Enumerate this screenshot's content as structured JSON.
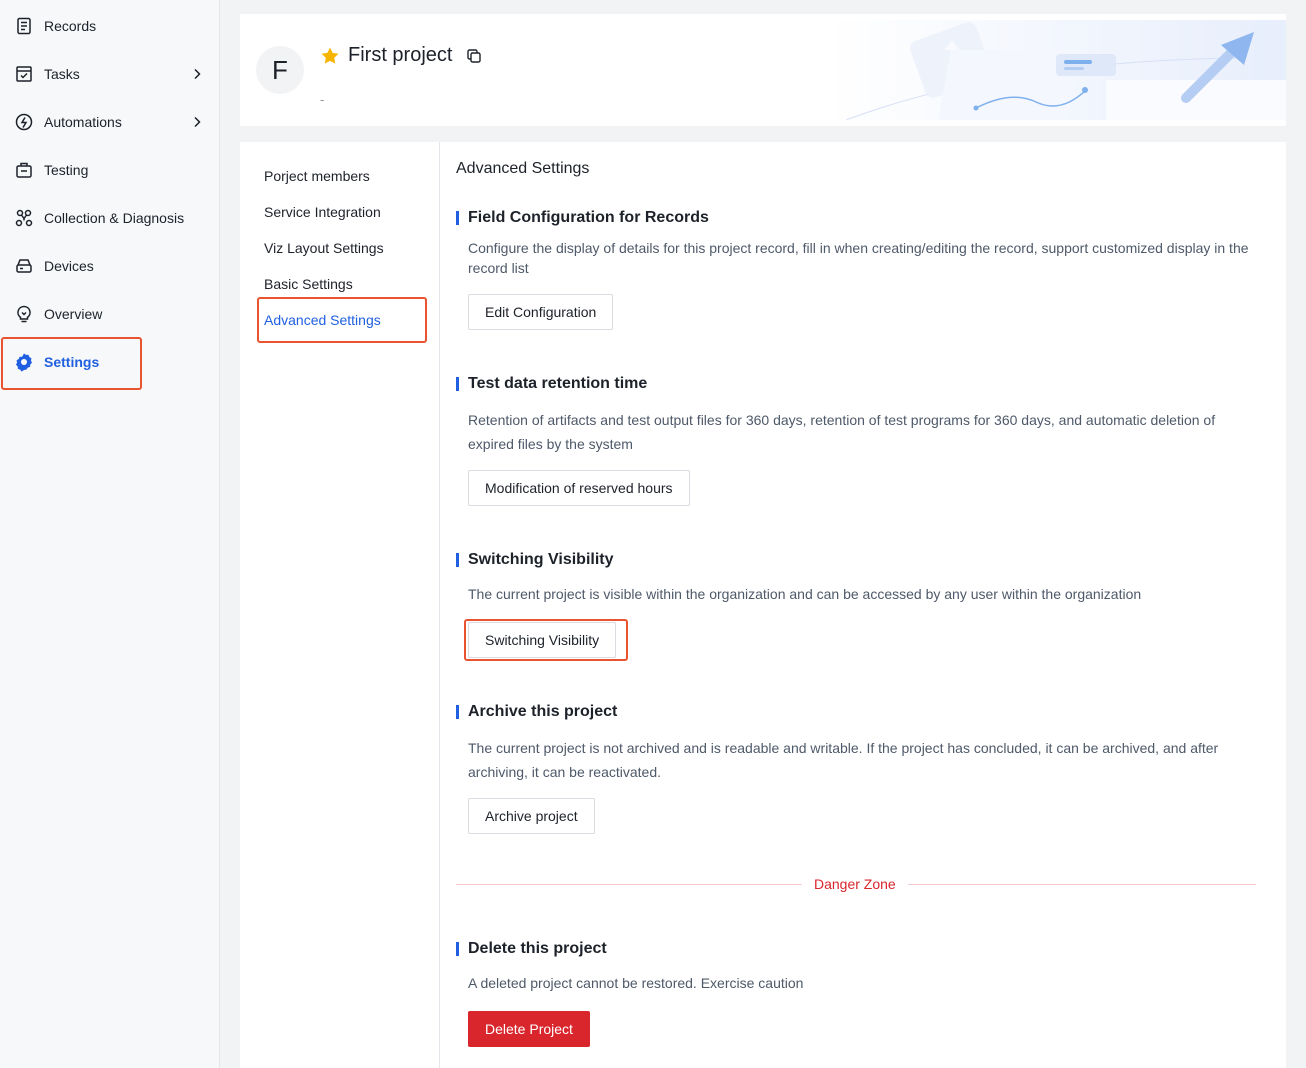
{
  "sidebar": {
    "items": [
      {
        "label": "Records",
        "icon": "records-icon"
      },
      {
        "label": "Tasks",
        "icon": "tasks-icon"
      },
      {
        "label": "Automations",
        "icon": "automations-icon"
      },
      {
        "label": "Testing",
        "icon": "testing-icon"
      },
      {
        "label": "Collection & Diagnosis",
        "icon": "collection-diagnosis-icon"
      },
      {
        "label": "Devices",
        "icon": "devices-icon"
      },
      {
        "label": "Overview",
        "icon": "overview-icon"
      },
      {
        "label": "Settings",
        "icon": "settings-icon"
      }
    ],
    "active": "Settings",
    "accent_color": "#1f5fe0"
  },
  "project": {
    "avatar_letter": "F",
    "title": "First project",
    "subtitle": "-",
    "favorite": true
  },
  "settings_nav": {
    "items": [
      {
        "label": "Porject members"
      },
      {
        "label": "Service Integration"
      },
      {
        "label": "Viz Layout Settings"
      },
      {
        "label": "Basic Settings"
      },
      {
        "label": "Advanced Settings"
      }
    ],
    "active": "Advanced Settings"
  },
  "content": {
    "title": "Advanced Settings",
    "sections": [
      {
        "title": "Field Configuration for Records",
        "description": "Configure the display of details for this project record, fill in when creating/editing the record, support customized display in the record list",
        "button": "Edit Configuration"
      },
      {
        "title": "Test data retention time",
        "description": "Retention of artifacts and test output files for 360 days, retention of test programs for 360 days, and automatic deletion of expired files by the system",
        "button": "Modification of reserved hours"
      },
      {
        "title": "Switching Visibility",
        "description": "The current project is visible within the organization and can be accessed by any user within the organization",
        "button": "Switching Visibility"
      },
      {
        "title": "Archive this project",
        "description": "The current project is not archived and is readable and writable. If the project has concluded, it can be archived, and after archiving, it can be reactivated.",
        "button": "Archive project"
      }
    ],
    "danger_zone": {
      "label": "Danger Zone",
      "title": "Delete this project",
      "description": "A deleted project cannot be restored. Exercise caution",
      "button": "Delete Project",
      "color": "#d9252c"
    }
  },
  "highlight_color": "#e8542f"
}
